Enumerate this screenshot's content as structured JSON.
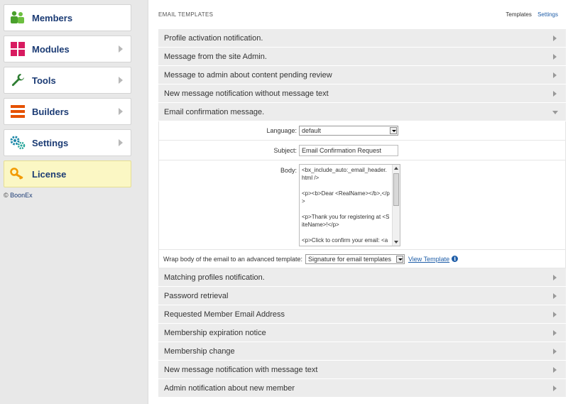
{
  "sidebar": {
    "items": [
      {
        "label": "Members",
        "icon": "members-icon",
        "has_chevron": false
      },
      {
        "label": "Modules",
        "icon": "modules-icon",
        "has_chevron": true
      },
      {
        "label": "Tools",
        "icon": "tools-icon",
        "has_chevron": true
      },
      {
        "label": "Builders",
        "icon": "builders-icon",
        "has_chevron": true
      },
      {
        "label": "Settings",
        "icon": "settings-icon",
        "has_chevron": true
      },
      {
        "label": "License",
        "icon": "key-icon",
        "has_chevron": false
      }
    ],
    "copyright_symbol": "©",
    "copyright_link": "BoonEx"
  },
  "header": {
    "title": "EMAIL TEMPLATES",
    "links": {
      "templates": "Templates",
      "settings": "Settings"
    }
  },
  "templates": {
    "before": [
      "Profile activation notification.",
      "Message from the site Admin.",
      "Message to admin about content pending review",
      "New message notification without message text"
    ],
    "expanded": "Email confirmation message.",
    "after": [
      "Matching profiles notification.",
      "Password retrieval",
      "Requested Member Email Address",
      "Membership expiration notice",
      "Membership change",
      "New message notification with message text",
      "Admin notification about new member"
    ]
  },
  "form": {
    "language_label": "Language:",
    "language_value": "default",
    "subject_label": "Subject:",
    "subject_value": "Email Confirmation Request",
    "body_label": "Body:",
    "body_lines": [
      "<bx_include_auto:_email_header.html />",
      "<p><b>Dear <RealName></b>,</p>",
      "<p>Thank you for registering at <SiteName>!</p>",
      "<p>Click to confirm your email: <a href=\"<ConfirmationLink>\">"
    ],
    "wrap_label": "Wrap body of the email to an advanced template:",
    "wrap_value": "Signature for email templates",
    "view_template": "View Template",
    "info_glyph": "i"
  },
  "colors": {
    "sidebar_label": "#1b3b74",
    "license_bg": "#fbf7c4",
    "link": "#1f5ea8",
    "row_bg": "#ececec"
  }
}
